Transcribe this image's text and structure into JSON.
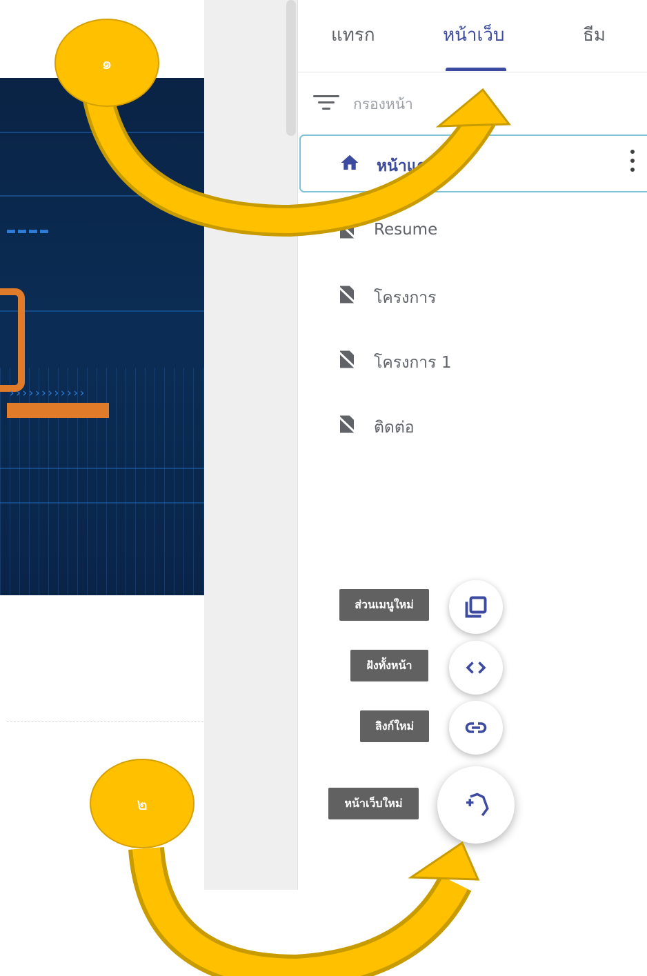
{
  "tabs": [
    {
      "label": "แทรก",
      "active": false
    },
    {
      "label": "หน้าเว็บ",
      "active": true
    },
    {
      "label": "ธีม",
      "active": false
    }
  ],
  "filter": {
    "placeholder": "กรองหน้า",
    "icon": "filter-icon"
  },
  "pages": [
    {
      "label": "หน้าแรก",
      "icon": "home-icon",
      "selected": true
    },
    {
      "label": "Resume",
      "icon": "hidden-page-icon",
      "selected": false
    },
    {
      "label": "โครงการ",
      "icon": "hidden-page-icon",
      "selected": false
    },
    {
      "label": "โครงการ 1",
      "icon": "hidden-page-icon",
      "selected": false
    },
    {
      "label": "ติดต่อ",
      "icon": "hidden-page-icon",
      "selected": false
    }
  ],
  "fab_menu": [
    {
      "label": "ส่วนเมนูใหม่",
      "icon": "new-menu-section-icon"
    },
    {
      "label": "ฝังทั้งหน้า",
      "icon": "embed-code-icon"
    },
    {
      "label": "ลิงก์ใหม่",
      "icon": "link-icon"
    },
    {
      "label": "หน้าเว็บใหม่",
      "icon": "add-page-icon"
    }
  ],
  "annotations": [
    {
      "number": "๑"
    },
    {
      "number": "๒"
    }
  ],
  "colors": {
    "accent": "#3c4aa0",
    "callout": "#ffc000",
    "arrow_dark": "#c89b00",
    "preview_bg": "#0a2345",
    "preview_orange": "#e07b2a"
  }
}
